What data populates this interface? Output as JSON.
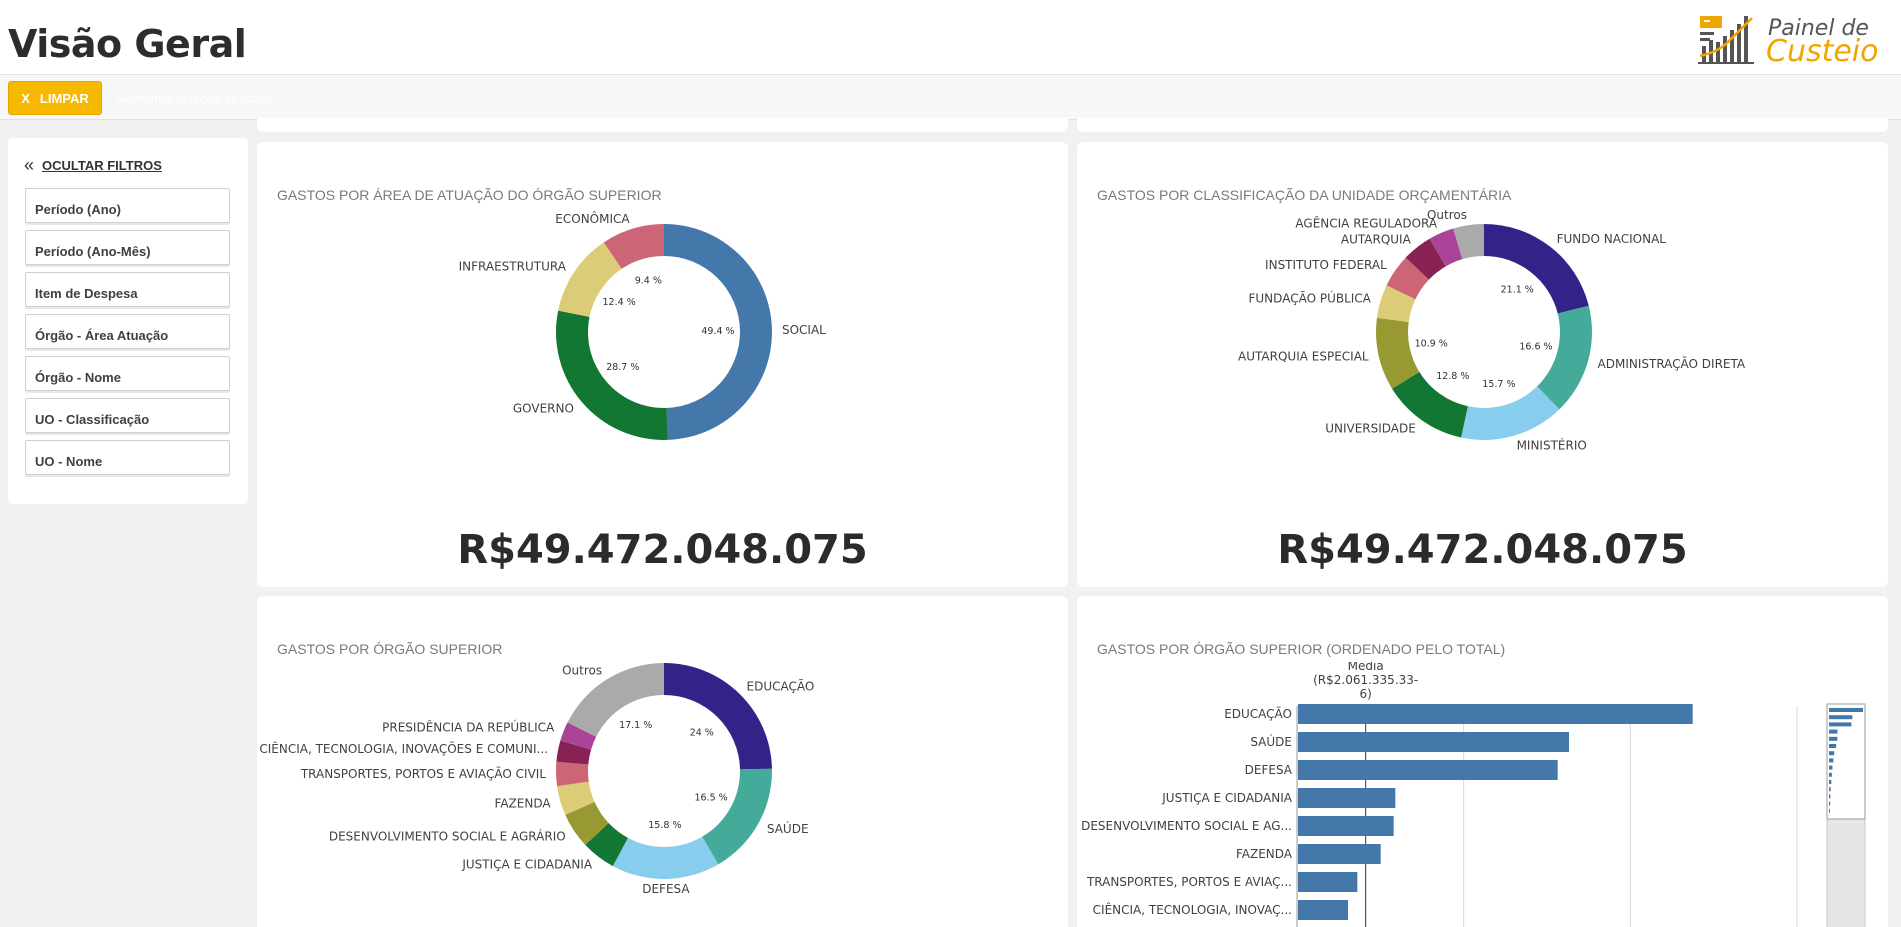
{
  "header": {
    "title": "Visão Geral",
    "logo": {
      "line1": "Painel de",
      "line2": "Custeio"
    }
  },
  "toolbar": {
    "clear_icon": "X",
    "clear_label": "LIMPAR",
    "ghost_text": "Nenhuma seleção aplicada"
  },
  "sidebar": {
    "hide_label": "OCULTAR FILTROS",
    "filters": [
      {
        "label": "Período (Ano)"
      },
      {
        "label": "Período (Ano-Mês)"
      },
      {
        "label": "Item de Despesa"
      },
      {
        "label": "Órgão - Área Atuação"
      },
      {
        "label": "Órgão - Nome"
      },
      {
        "label": "UO - Classificação"
      },
      {
        "label": "UO - Nome"
      }
    ]
  },
  "cards": {
    "area": {
      "title": "GASTOS POR ÁREA DE ATUAÇÃO DO ÓRGÃO SUPERIOR",
      "kpi": "R$49.472.048.075"
    },
    "classificacao": {
      "title": "GASTOS POR CLASSIFICAÇÃO DA UNIDADE ORÇAMENTÁRIA",
      "kpi": "R$49.472.048.075"
    },
    "orgao": {
      "title": "GASTOS POR ÓRGÃO SUPERIOR"
    },
    "ordenado": {
      "title": "GASTOS POR ÓRGÃO SUPERIOR (ORDENADO PELO TOTAL)"
    }
  },
  "chart_data": [
    {
      "id": "area",
      "type": "pie",
      "categories": [
        "SOCIAL",
        "GOVERNO",
        "INFRAESTRUTURA",
        "ECONÔMICA"
      ],
      "values": [
        49.4,
        28.7,
        12.4,
        9.4
      ],
      "pct_labels": [
        "49.4 %",
        "28.7 %",
        "12.4 %",
        "9.4 %"
      ],
      "colors": [
        "#4477aa",
        "#117733",
        "#ddcc77",
        "#cc6677"
      ]
    },
    {
      "id": "classificacao",
      "type": "pie",
      "categories": [
        "FUNDO NACIONAL",
        "ADMINISTRAÇÃO DIRETA",
        "MINISTÉRIO",
        "UNIVERSIDADE",
        "AUTARQUIA ESPECIAL",
        "FUNDAÇÃO PÚBLICA",
        "INSTITUTO FEDERAL",
        "AUTARQUIA",
        "AGÊNCIA REGULADORA",
        "Outros"
      ],
      "values": [
        21.1,
        16.6,
        15.7,
        12.8,
        10.9,
        5.0,
        5.0,
        4.5,
        3.8,
        4.6
      ],
      "pct_labels": [
        "21.1 %",
        "16.6 %",
        "15.7 %",
        "12.8 %",
        "10.9 %",
        "",
        "",
        "",
        "",
        ""
      ],
      "colors": [
        "#332288",
        "#44aa99",
        "#88ccee",
        "#117733",
        "#999933",
        "#ddcc77",
        "#cc6677",
        "#882255",
        "#aa4499",
        "#aaaaaa"
      ]
    },
    {
      "id": "orgao",
      "type": "pie",
      "categories": [
        "EDUCAÇÃO",
        "SAÚDE",
        "DEFESA",
        "JUSTIÇA E CIDADANIA",
        "DESENVOLVIMENTO SOCIAL E AGRÁRIO",
        "FAZENDA",
        "TRANSPORTES, PORTOS E AVIAÇÃO CIVIL",
        "CIÊNCIA, TECNOLOGIA, INOVAÇÕES E COMUNI...",
        "PRESIDÊNCIA DA REPÚBLICA",
        "Outros"
      ],
      "values": [
        24.0,
        16.5,
        15.8,
        5.0,
        5.2,
        4.3,
        3.5,
        3.1,
        2.8,
        17.1
      ],
      "pct_labels": [
        "24 %",
        "16.5 %",
        "15.8 %",
        "",
        "",
        "",
        "",
        "",
        "",
        "17.1 %"
      ],
      "colors": [
        "#332288",
        "#44aa99",
        "#88ccee",
        "#117733",
        "#999933",
        "#ddcc77",
        "#cc6677",
        "#882255",
        "#aa4499",
        "#aaaaaa"
      ]
    },
    {
      "id": "ordenado",
      "type": "bar",
      "orientation": "horizontal",
      "categories": [
        "EDUCAÇÃO",
        "SAÚDE",
        "DEFESA",
        "JUSTIÇA E CIDADANIA",
        "DESENVOLVIMENTO SOCIAL E AG...",
        "FAZENDA",
        "TRANSPORTES, PORTOS E AVIAÇ...",
        "CIÊNCIA, TECNOLOGIA, INOVAÇ..."
      ],
      "values": [
        11.87,
        8.16,
        7.82,
        2.95,
        2.9,
        2.51,
        1.81,
        1.53
      ],
      "value_unit": "R$ bilhões",
      "xlim": [
        0,
        15
      ],
      "reference_line": {
        "label": "Média",
        "value_label": "(R$2.061.335.33-",
        "value_label2": "6)",
        "value": 2.06
      },
      "color": "#4477aa",
      "grid": true,
      "minimap_values": [
        11.87,
        8.16,
        7.82,
        2.95,
        2.9,
        2.51,
        1.81,
        1.53,
        1.2,
        1.0,
        0.8,
        0.6,
        0.5,
        0.4,
        0.3
      ]
    }
  ]
}
